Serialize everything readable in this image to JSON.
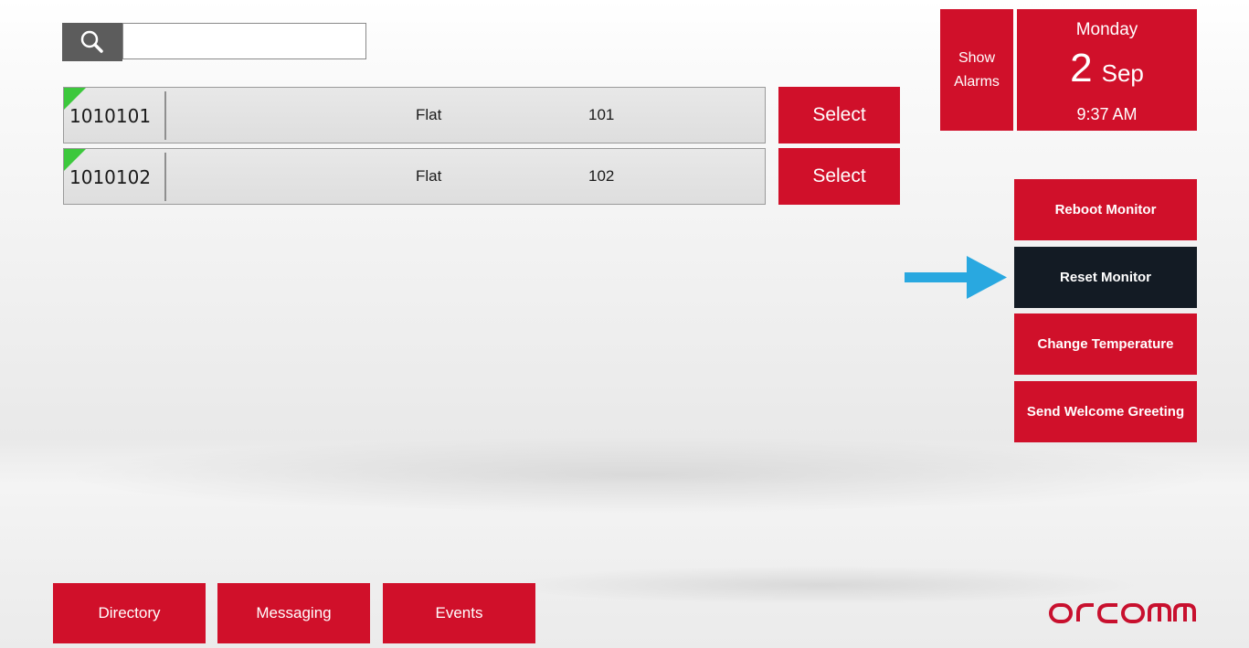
{
  "search": {
    "value": "",
    "placeholder": ""
  },
  "rows": [
    {
      "id": "1010101",
      "type": "Flat",
      "number": "101",
      "select_label": "Select"
    },
    {
      "id": "1010102",
      "type": "Flat",
      "number": "102",
      "select_label": "Select"
    }
  ],
  "header": {
    "alarms_line1": "Show",
    "alarms_line2": "Alarms",
    "day": "Monday",
    "date_num": "2",
    "date_month": "Sep",
    "time": "9:37 AM"
  },
  "actions": {
    "reboot": "Reboot Monitor",
    "reset": "Reset Monitor",
    "change_temp": "Change Temperature",
    "welcome": "Send Welcome Greeting"
  },
  "nav": {
    "directory": "Directory",
    "messaging": "Messaging",
    "events": "Events"
  },
  "brand": {
    "logo": "orcomm"
  },
  "colors": {
    "accent": "#d0102a",
    "dark_button": "#131b24",
    "status_online": "#3cc83c",
    "arrow": "#29a8e0"
  },
  "icons": {
    "search": "search-icon",
    "arrow": "arrow-right-icon"
  }
}
